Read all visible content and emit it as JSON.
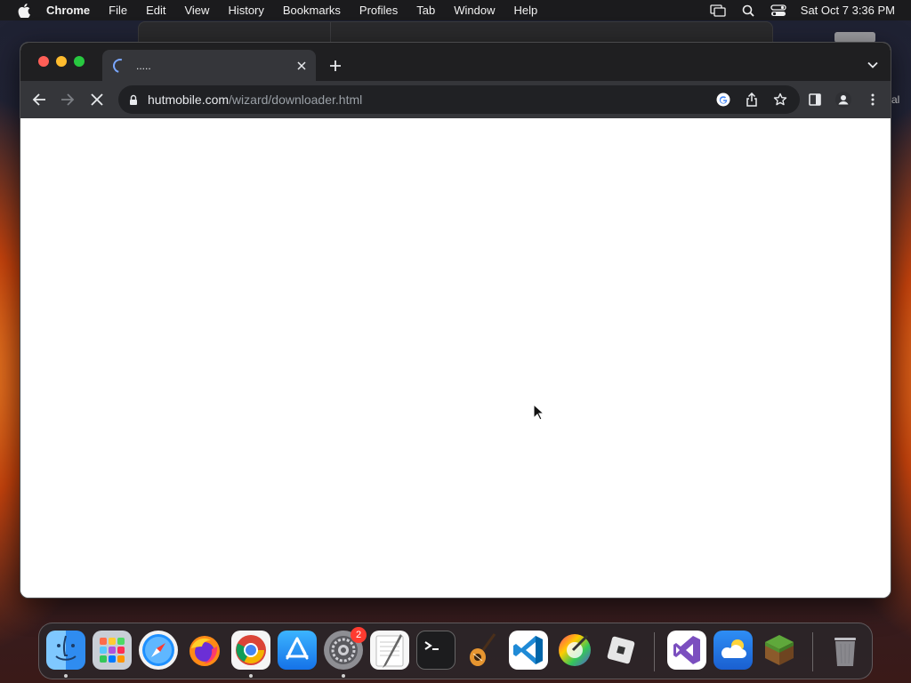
{
  "menubar": {
    "app_name": "Chrome",
    "items": [
      "File",
      "Edit",
      "View",
      "History",
      "Bookmarks",
      "Profiles",
      "Tab",
      "Window",
      "Help"
    ],
    "clock": "Sat Oct 7  3:36 PM"
  },
  "desktop": {
    "edge_text": "al"
  },
  "browser": {
    "tab": {
      "title": ".....",
      "loading": true
    },
    "url": {
      "domain": "hutmobile.com",
      "path": "/wizard/downloader.html"
    }
  },
  "dock": {
    "apps": [
      {
        "name": "Finder",
        "icon": "finder-icon",
        "running": true
      },
      {
        "name": "Launchpad",
        "icon": "launchpad-icon",
        "running": false
      },
      {
        "name": "Safari",
        "icon": "safari-icon",
        "running": false
      },
      {
        "name": "Firefox",
        "icon": "firefox-icon",
        "running": false
      },
      {
        "name": "Google Chrome",
        "icon": "chrome-icon",
        "running": true
      },
      {
        "name": "App Store",
        "icon": "app-store-icon",
        "running": false
      },
      {
        "name": "System Settings",
        "icon": "settings-icon",
        "running": true,
        "badge": "2"
      },
      {
        "name": "TextEdit",
        "icon": "textedit-icon",
        "running": false
      },
      {
        "name": "Terminal",
        "icon": "terminal-icon",
        "running": false
      },
      {
        "name": "GarageBand",
        "icon": "garageband-icon",
        "running": false
      },
      {
        "name": "Visual Studio Code",
        "icon": "vscode-icon",
        "running": false
      },
      {
        "name": "Color Picker",
        "icon": "color-picker-icon",
        "running": false
      },
      {
        "name": "Roblox",
        "icon": "roblox-icon",
        "running": false
      },
      {
        "name": "Visual Studio",
        "icon": "visual-studio-icon",
        "running": false
      },
      {
        "name": "Weather",
        "icon": "weather-icon",
        "running": false
      },
      {
        "name": "Minecraft",
        "icon": "minecraft-icon",
        "running": false
      },
      {
        "name": "Trash",
        "icon": "trash-icon",
        "running": false
      }
    ]
  }
}
